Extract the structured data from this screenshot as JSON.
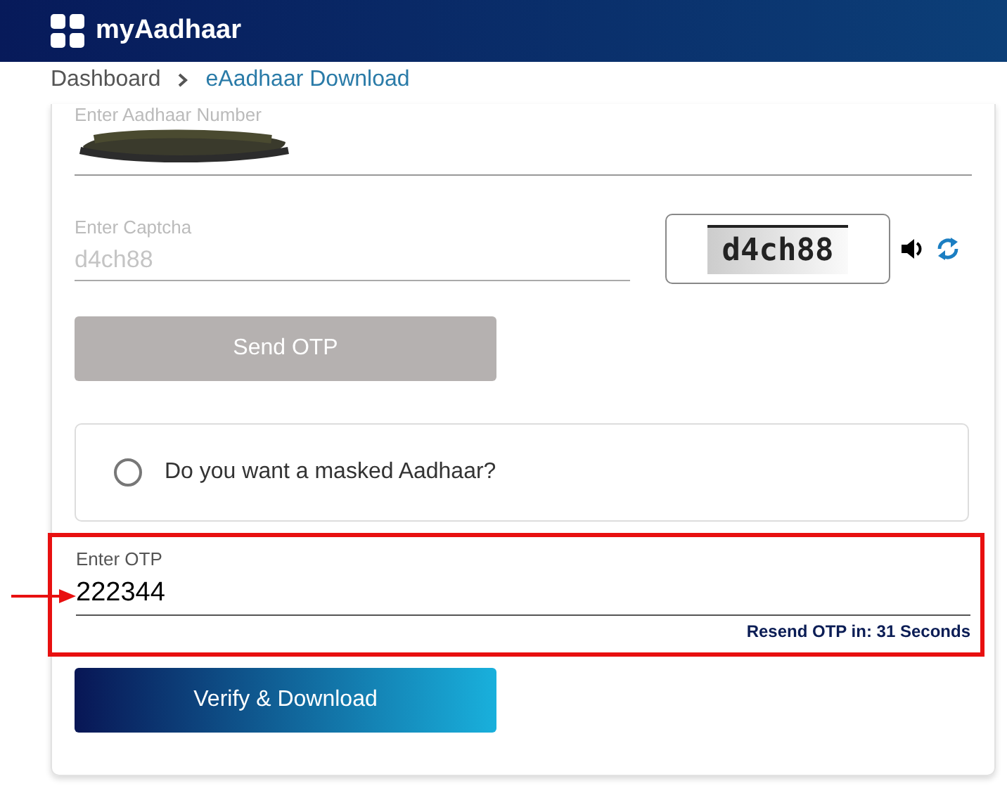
{
  "header": {
    "title": "myAadhaar"
  },
  "breadcrumb": {
    "items": [
      "Dashboard",
      "eAadhaar Download"
    ]
  },
  "aadhaar_field": {
    "label": "Enter Aadhaar Number",
    "redacted": true
  },
  "captcha_field": {
    "label": "Enter Captcha",
    "placeholder": "d4ch88"
  },
  "captcha": {
    "image_text": "d4ch88"
  },
  "send_button": {
    "label": "Send OTP",
    "disabled": true
  },
  "masked_option": {
    "label": "Do you want a masked Aadhaar?",
    "selected": false
  },
  "otp_field": {
    "label": "Enter OTP",
    "value": "222344",
    "highlighted": true
  },
  "resend_text": "Resend OTP in: 31 Seconds",
  "verify_button": {
    "label": "Verify & Download",
    "disabled": false
  }
}
